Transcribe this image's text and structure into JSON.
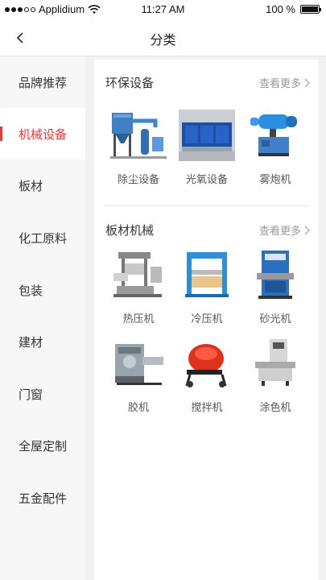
{
  "status_bar": {
    "carrier": "Applidium",
    "time": "11:27 AM",
    "battery": "100 %"
  },
  "nav": {
    "title": "分类"
  },
  "sidebar": {
    "items": [
      {
        "label": "品牌推荐"
      },
      {
        "label": "机械设备"
      },
      {
        "label": "板材"
      },
      {
        "label": "化工原料"
      },
      {
        "label": "包装"
      },
      {
        "label": "建材"
      },
      {
        "label": "门窗"
      },
      {
        "label": "全屋定制"
      },
      {
        "label": "五金配件"
      }
    ],
    "active_index": 1
  },
  "sections": [
    {
      "title": "环保设备",
      "more": "查看更多",
      "products": [
        {
          "label": "除尘设备"
        },
        {
          "label": "光氧设备"
        },
        {
          "label": "雾炮机"
        }
      ]
    },
    {
      "title": "板材机械",
      "more": "查看更多",
      "products": [
        {
          "label": "热压机"
        },
        {
          "label": "冷压机"
        },
        {
          "label": "砂光机"
        },
        {
          "label": "胶机"
        },
        {
          "label": "搅拌机"
        },
        {
          "label": "涂色机"
        }
      ]
    }
  ],
  "colors": {
    "accent": "#e53935",
    "sidebar_bg": "#f7f7f7",
    "page_bg": "#f2f2f2"
  }
}
